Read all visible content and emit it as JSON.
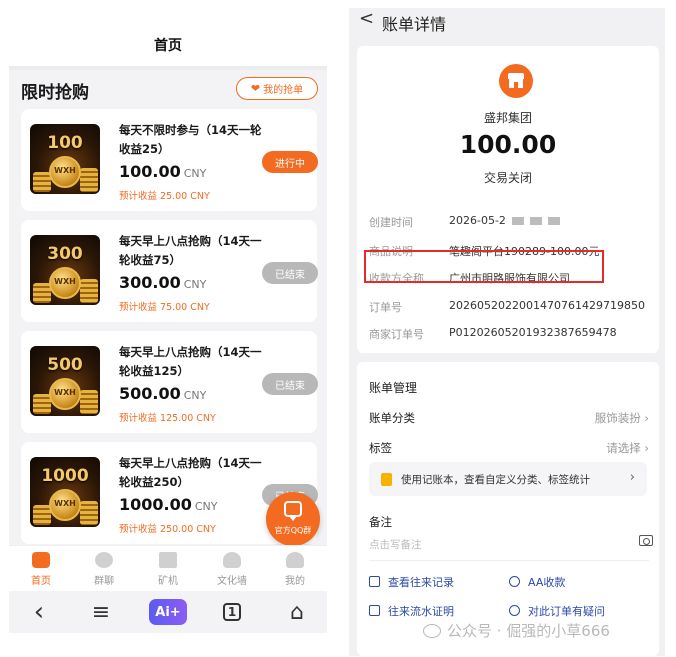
{
  "left": {
    "header_title": "首页",
    "section_title": "限时抢购",
    "my_orders_label": "我的抢单",
    "products": [
      {
        "badge": "100",
        "coin": "WXH",
        "name": "每天不限时参与（14天一轮收益25）",
        "price": "100.00",
        "currency": "CNY",
        "earn": "预计收益 25.00 CNY",
        "status": "进行中",
        "state": "active"
      },
      {
        "badge": "300",
        "coin": "WXH",
        "name": "每天早上八点抢购（14天一轮收益75）",
        "price": "300.00",
        "currency": "CNY",
        "earn": "预计收益 75.00 CNY",
        "status": "已结束",
        "state": "ended"
      },
      {
        "badge": "500",
        "coin": "WXH",
        "name": "每天早上八点抢购（14天一轮收益125）",
        "price": "500.00",
        "currency": "CNY",
        "earn": "预计收益 125.00 CNY",
        "status": "已结束",
        "state": "ended"
      },
      {
        "badge": "1000",
        "coin": "WXH",
        "name": "每天早上八点抢购（14天一轮收益250）",
        "price": "1000.00",
        "currency": "CNY",
        "earn": "预计收益 250.00 CNY",
        "status": "已结束",
        "state": "ended"
      }
    ],
    "fab_label": "官方QQ群",
    "tabs": [
      "首页",
      "群聊",
      "矿机",
      "文化墙",
      "我的"
    ],
    "active_tab": 0,
    "sys": {
      "back": "‹",
      "menu": "≡",
      "ai": "Ai+",
      "one": "1",
      "home": "⌂"
    }
  },
  "right": {
    "header_title": "账单详情",
    "merchant": "盛邦集团",
    "amount": "100.00",
    "trade_status": "交易关闭",
    "details": [
      {
        "key": "创建时间",
        "value": "2026-05-2"
      },
      {
        "key": "商品说明",
        "value": "笔趣阁平台190289-100.00元"
      },
      {
        "key": "收款方全称",
        "value": "广州市明路服饰有限公司"
      },
      {
        "key": "订单号",
        "value": "2026052022001470761429719850"
      },
      {
        "key": "商家订单号",
        "value": "P01202605201932387659478"
      }
    ],
    "management_title": "账单管理",
    "category_label": "账单分类",
    "category_value": "服饰装扮",
    "tag_label": "标签",
    "tag_value": "请选择",
    "tip_text": "使用记账本，查看自定义分类、标签统计",
    "note_label": "备注",
    "note_placeholder": "点击写备注",
    "links": [
      "查看往来记录",
      "AA收款",
      "往来流水证明",
      "对此订单有疑问"
    ],
    "chevron": "›"
  },
  "watermark": "公众号 · 倔强的小草666",
  "colors": {
    "accent": "#f26b20",
    "highlight_border": "#e52a2a",
    "link": "#2b4aa8"
  }
}
